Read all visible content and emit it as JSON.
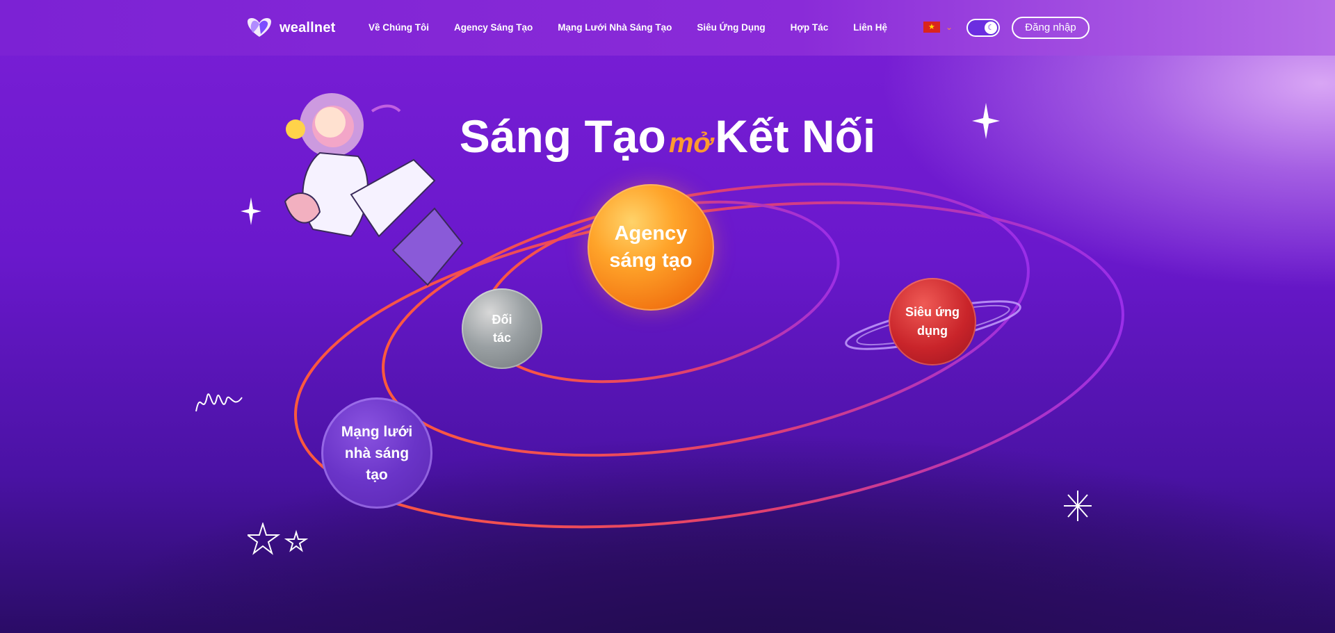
{
  "brand": {
    "name": "weallnet"
  },
  "nav": {
    "items": [
      "Về Chúng Tôi",
      "Agency Sáng Tạo",
      "Mạng Lưới Nhà Sáng Tạo",
      "Siêu Ứng Dụng",
      "Hợp Tác",
      "Liên Hệ"
    ]
  },
  "header": {
    "login_label": "Đăng nhập"
  },
  "hero": {
    "title_left": "Sáng Tạo",
    "title_mid": "mở",
    "title_right": "Kết Nối"
  },
  "planets": {
    "agency": [
      "Agency",
      "sáng tạo"
    ],
    "doitac": [
      "Đối",
      "tác"
    ],
    "sieu": [
      "Siêu ứng",
      "dụng"
    ],
    "mang": [
      "Mạng lưới",
      "nhà sáng",
      "tạo"
    ]
  },
  "colors": {
    "accent_orange": "#ff9a2e",
    "brand_purple": "#7c22d4",
    "planet_red": "#c9242a",
    "planet_gray": "#9aa0a3"
  }
}
